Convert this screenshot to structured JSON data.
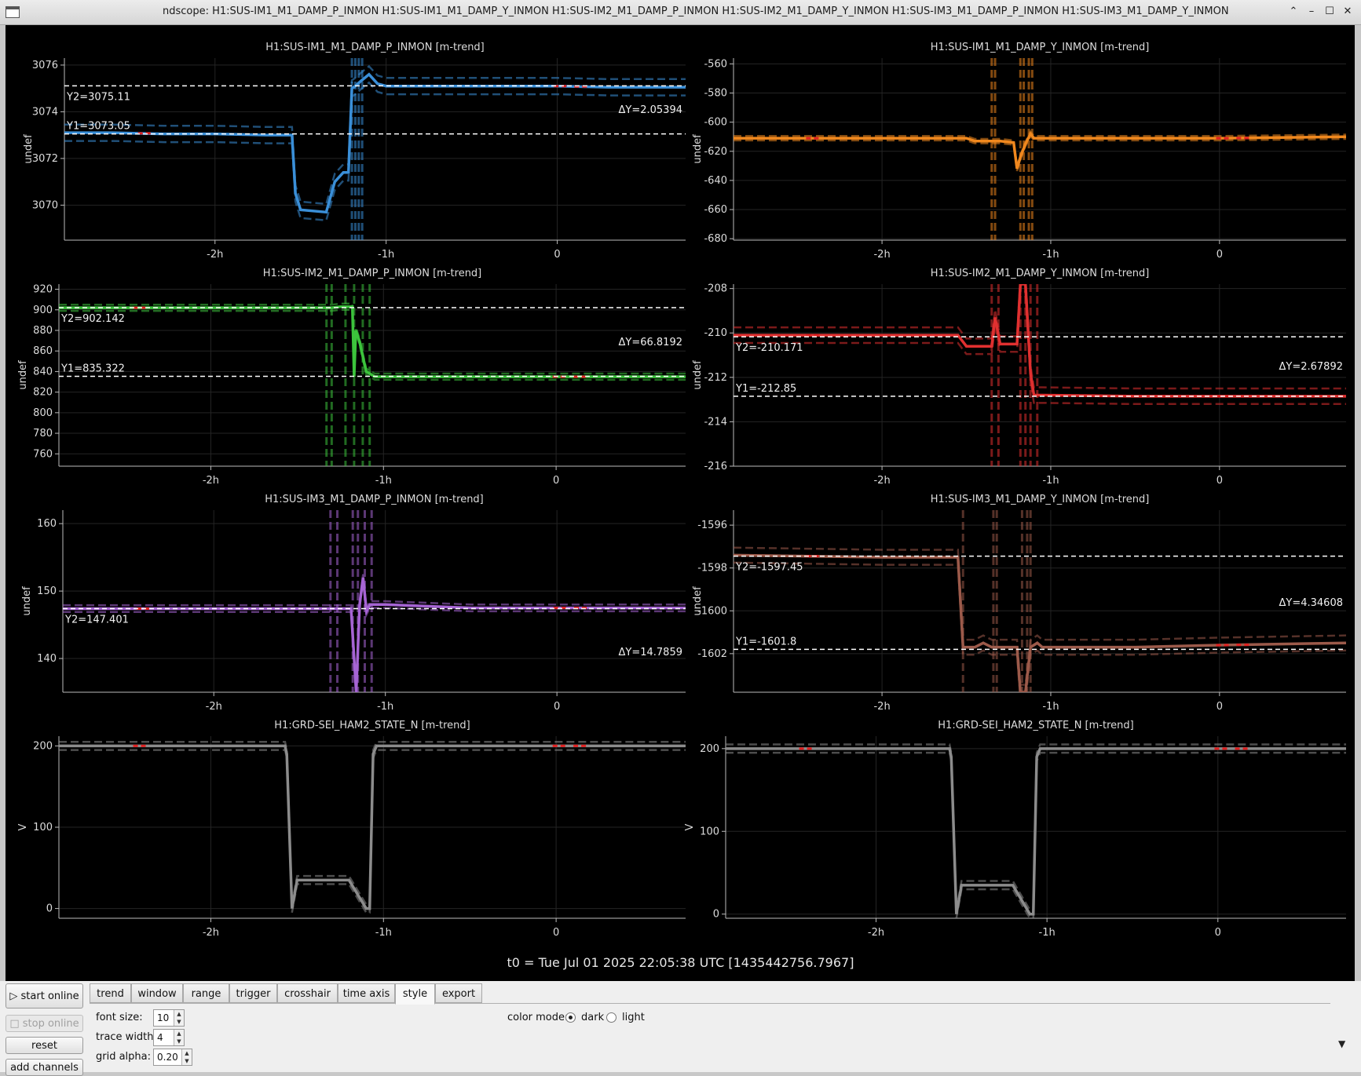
{
  "window": {
    "title": "ndscope: H1:SUS-IM1_M1_DAMP_P_INMON H1:SUS-IM1_M1_DAMP_Y_INMON H1:SUS-IM2_M1_DAMP_P_INMON H1:SUS-IM2_M1_DAMP_Y_INMON H1:SUS-IM3_M1_DAMP_P_INMON H1:SUS-IM3_M1_DAMP_Y_INMON",
    "buttons": {
      "shade": "⌃",
      "minimize": "–",
      "maximize": "☐",
      "close": "✕"
    }
  },
  "t0_label": "t0 = Tue Jul 01 2025 22:05:38 UTC [1435442756.7967]",
  "colors": {
    "background": "#000000",
    "grid": "#242424",
    "axis": "#bbbbbb",
    "cursor": "#ffffff",
    "gap": "#e02020"
  },
  "x_axis": {
    "ticks": [
      {
        "value": -2,
        "label": "-2h"
      },
      {
        "value": -1,
        "label": "-1h"
      },
      {
        "value": 0,
        "label": "0"
      }
    ]
  },
  "chart_data": [
    {
      "type": "line",
      "title": "H1:SUS-IM1_M1_DAMP_P_INMON [m-trend]",
      "ylabel": "undef",
      "color": "#3a8fd8",
      "xlim": [
        -2.88,
        0.75
      ],
      "ylim": [
        3068.5,
        3076.3
      ],
      "yticks": [
        3070,
        3072,
        3074,
        3076
      ],
      "y1": {
        "value": 3073.05,
        "label": "Y1=3073.05"
      },
      "y2": {
        "value": 3075.11,
        "label": "Y2=3075.11"
      },
      "delta_label": "ΔY=2.05394",
      "series": [
        {
          "x": [
            -2.88,
            -2.6,
            -2.3,
            -2.0,
            -1.7,
            -1.55,
            -1.53,
            -1.5,
            -1.35,
            -1.3,
            -1.25,
            -1.22,
            -1.2,
            -1.18,
            -1.15,
            -1.1,
            -1.05,
            -1.0,
            -0.5,
            0.0,
            0.3,
            0.75
          ],
          "y": [
            3073.1,
            3073.1,
            3073.05,
            3073.05,
            3073.0,
            3073.0,
            3070.5,
            3069.8,
            3069.7,
            3071.0,
            3071.4,
            3071.4,
            3075.0,
            3075.1,
            3075.3,
            3075.6,
            3075.2,
            3075.1,
            3075.1,
            3075.1,
            3075.05,
            3075.05
          ],
          "spread": 0.35
        }
      ],
      "band_lines": [
        -1.2,
        -1.18,
        -1.16,
        -1.14
      ]
    },
    {
      "type": "line",
      "title": "H1:SUS-IM1_M1_DAMP_Y_INMON [m-trend]",
      "ylabel": "undef",
      "color": "#f0881e",
      "xlim": [
        -2.88,
        0.75
      ],
      "ylim": [
        -681,
        -556
      ],
      "yticks": [
        -560,
        -580,
        -600,
        -620,
        -640,
        -660,
        -680
      ],
      "y1": null,
      "y2": null,
      "delta_label": "",
      "series": [
        {
          "x": [
            -2.88,
            -2.0,
            -1.5,
            -1.45,
            -1.3,
            -1.22,
            -1.2,
            -1.18,
            -1.15,
            -1.12,
            -1.1,
            -1.05,
            -0.5,
            0.0,
            0.75
          ],
          "y": [
            -611,
            -611,
            -611,
            -613,
            -613,
            -614,
            -632,
            -624,
            -615,
            -608,
            -611,
            -611,
            -611,
            -611,
            -610
          ],
          "spread": 1.5
        }
      ],
      "band_lines": [
        -1.35,
        -1.33,
        -1.18,
        -1.16,
        -1.13,
        -1.11
      ]
    },
    {
      "type": "line",
      "title": "H1:SUS-IM2_M1_DAMP_P_INMON [m-trend]",
      "ylabel": "undef",
      "color": "#3cc43c",
      "xlim": [
        -2.88,
        0.75
      ],
      "ylim": [
        748,
        925
      ],
      "yticks": [
        920,
        900,
        880,
        860,
        840,
        820,
        800,
        780,
        760
      ],
      "y1": {
        "value": 835.322,
        "label": "Y1=835.322"
      },
      "y2": {
        "value": 902.142,
        "label": "Y2=902.142"
      },
      "delta_label": "ΔY=66.8192",
      "series": [
        {
          "x": [
            -2.88,
            -2.0,
            -1.5,
            -1.3,
            -1.25,
            -1.18,
            -1.17,
            -1.16,
            -1.14,
            -1.1,
            -1.05,
            -1.0,
            -0.5,
            0.0,
            0.75
          ],
          "y": [
            902,
            902,
            902,
            902,
            903,
            903,
            835,
            880,
            870,
            840,
            835,
            835,
            835,
            835,
            835
          ],
          "spread": 3
        }
      ],
      "band_lines": [
        -1.33,
        -1.3,
        -1.22,
        -1.17,
        -1.12,
        -1.08
      ]
    },
    {
      "type": "line",
      "title": "H1:SUS-IM2_M1_DAMP_Y_INMON [m-trend]",
      "ylabel": "undef",
      "color": "#e03030",
      "xlim": [
        -2.88,
        0.75
      ],
      "ylim": [
        -216,
        -207.8
      ],
      "yticks": [
        -208,
        -210,
        -212,
        -214,
        -216
      ],
      "y1": {
        "value": -212.85,
        "label": "Y1=-212.85"
      },
      "y2": {
        "value": -210.171,
        "label": "Y2=-210.171"
      },
      "delta_label": "ΔY=2.67892",
      "series": [
        {
          "x": [
            -2.88,
            -2.0,
            -1.6,
            -1.55,
            -1.5,
            -1.4,
            -1.35,
            -1.33,
            -1.3,
            -1.2,
            -1.18,
            -1.15,
            -1.12,
            -1.1,
            -1.05,
            -0.5,
            0.0,
            0.75
          ],
          "y": [
            -210.1,
            -210.1,
            -210.1,
            -210.1,
            -210.6,
            -210.6,
            -210.6,
            -209.3,
            -210.5,
            -210.5,
            -207.8,
            -207.8,
            -211.8,
            -212.8,
            -212.8,
            -212.85,
            -212.85,
            -212.85
          ],
          "spread": 0.35
        }
      ],
      "band_lines": [
        -1.35,
        -1.31,
        -1.18,
        -1.15,
        -1.12,
        -1.08
      ]
    },
    {
      "type": "line",
      "title": "H1:SUS-IM3_M1_DAMP_P_INMON [m-trend]",
      "ylabel": "undef",
      "color": "#a664d4",
      "xlim": [
        -2.88,
        0.75
      ],
      "ylim": [
        135,
        162
      ],
      "yticks": [
        160,
        150,
        140
      ],
      "y1": null,
      "y2": {
        "value": 147.401,
        "label": "Y2=147.401"
      },
      "delta_label": "ΔY=14.7859",
      "series": [
        {
          "x": [
            -2.88,
            -2.0,
            -1.5,
            -1.3,
            -1.2,
            -1.17,
            -1.15,
            -1.13,
            -1.11,
            -1.09,
            -1.07,
            -1.0,
            -0.5,
            0.0,
            0.75
          ],
          "y": [
            147.4,
            147.4,
            147.4,
            147.4,
            147.4,
            135,
            148,
            152,
            147,
            148,
            148,
            148,
            147.5,
            147.5,
            147.5
          ],
          "spread": 0.5
        }
      ],
      "band_lines": [
        -1.32,
        -1.28,
        -1.19,
        -1.16,
        -1.12,
        -1.08
      ]
    },
    {
      "type": "line",
      "title": "H1:SUS-IM3_M1_DAMP_Y_INMON [m-trend]",
      "ylabel": "undef",
      "color": "#9c5a4a",
      "xlim": [
        -2.88,
        0.75
      ],
      "ylim": [
        -1603.8,
        -1595.3
      ],
      "yticks": [
        -1596,
        -1598,
        -1600,
        -1602
      ],
      "y1": {
        "value": -1601.8,
        "label": "Y1=-1601.8"
      },
      "y2": {
        "value": -1597.45,
        "label": "Y2=-1597.45"
      },
      "delta_label": "ΔY=4.34608",
      "series": [
        {
          "x": [
            -2.88,
            -2.0,
            -1.55,
            -1.52,
            -1.45,
            -1.4,
            -1.35,
            -1.3,
            -1.2,
            -1.18,
            -1.15,
            -1.12,
            -1.08,
            -1.05,
            -0.5,
            0.0,
            0.75
          ],
          "y": [
            -1597.4,
            -1597.5,
            -1597.5,
            -1601.7,
            -1601.7,
            -1601.5,
            -1601.7,
            -1601.7,
            -1601.7,
            -1603.8,
            -1603.8,
            -1601.7,
            -1601.5,
            -1601.7,
            -1601.7,
            -1601.6,
            -1601.5
          ],
          "spread": 0.35
        }
      ],
      "band_lines": [
        -1.52,
        -1.34,
        -1.32,
        -1.17,
        -1.14,
        -1.12
      ]
    },
    {
      "type": "line",
      "title": "H1:GRD-SEI_HAM2_STATE_N [m-trend]",
      "ylabel": "V",
      "color": "#8c8c8c",
      "xlim": [
        -2.88,
        0.75
      ],
      "ylim": [
        -12,
        212
      ],
      "yticks": [
        200,
        100,
        0
      ],
      "y1": null,
      "y2": null,
      "delta_label": "",
      "series": [
        {
          "x": [
            -2.88,
            -2.0,
            -1.57,
            -1.56,
            -1.53,
            -1.5,
            -1.2,
            -1.1,
            -1.08,
            -1.06,
            -1.04,
            -0.5,
            0.0,
            0.75
          ],
          "y": [
            200,
            200,
            200,
            190,
            0,
            35,
            35,
            0,
            0,
            190,
            200,
            200,
            200,
            200
          ],
          "spread": 5
        }
      ],
      "band_lines": []
    },
    {
      "type": "line",
      "title": "H1:GRD-SEI_HAM2_STATE_N [m-trend]",
      "ylabel": "V",
      "color": "#8c8c8c",
      "xlim": [
        -2.88,
        0.75
      ],
      "ylim": [
        -5,
        215
      ],
      "yticks": [
        200,
        100,
        0
      ],
      "y1": null,
      "y2": null,
      "delta_label": "",
      "series": [
        {
          "x": [
            -2.88,
            -2.0,
            -1.57,
            -1.56,
            -1.53,
            -1.5,
            -1.2,
            -1.1,
            -1.08,
            -1.06,
            -1.04,
            -0.5,
            0.0,
            0.75
          ],
          "y": [
            200,
            200,
            200,
            190,
            0,
            35,
            35,
            0,
            0,
            190,
            200,
            200,
            200,
            200
          ],
          "spread": 5
        }
      ],
      "band_lines": []
    }
  ],
  "controls": {
    "start_online": "start online",
    "stop_online": "stop online",
    "reset": "reset",
    "add_channels": "add channels",
    "tabs": [
      "trend",
      "window",
      "range",
      "trigger",
      "crosshair",
      "time axis",
      "style",
      "export"
    ],
    "active_tab": "style",
    "style": {
      "font_size_label": "font size:",
      "font_size_value": "10",
      "trace_width_label": "trace width:",
      "trace_width_value": "4",
      "grid_alpha_label": "grid alpha:",
      "grid_alpha_value": "0.20",
      "color_mode_label": "color mode:",
      "dark_label": "dark",
      "light_label": "light",
      "color_mode_selected": "dark"
    }
  }
}
